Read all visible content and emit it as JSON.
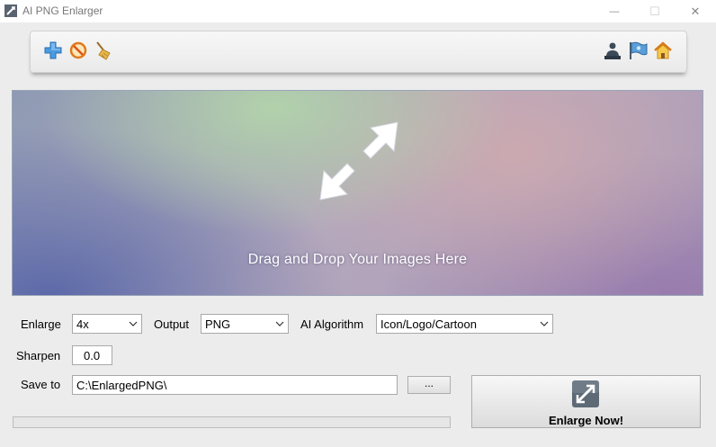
{
  "window": {
    "title": "AI PNG Enlarger",
    "minimize_glyph": "—",
    "maximize_glyph": "☐",
    "close_glyph": "✕"
  },
  "toolbar": {
    "icons": [
      "add-icon",
      "remove-icon",
      "clear-broom-icon",
      "user-icon",
      "flag-icon",
      "home-icon"
    ]
  },
  "dropzone": {
    "text": "Drag and Drop Your Images Here",
    "icon": "resize-arrow-icon"
  },
  "settings": {
    "enlarge_label": "Enlarge",
    "enlarge_value": "4x",
    "output_label": "Output",
    "output_value": "PNG",
    "algorithm_label": "AI Algorithm",
    "algorithm_value": "Icon/Logo/Cartoon",
    "sharpen_label": "Sharpen",
    "sharpen_value": "0.0",
    "save_to_label": "Save to",
    "save_to_value": "C:\\EnlargedPNG\\",
    "browse_label": "..."
  },
  "progress": {
    "value": 0
  },
  "action": {
    "enlarge_now_label": "Enlarge Now!"
  },
  "colors": {
    "accent_blue": "#3a8fd8",
    "progress_green": "#06b025"
  }
}
